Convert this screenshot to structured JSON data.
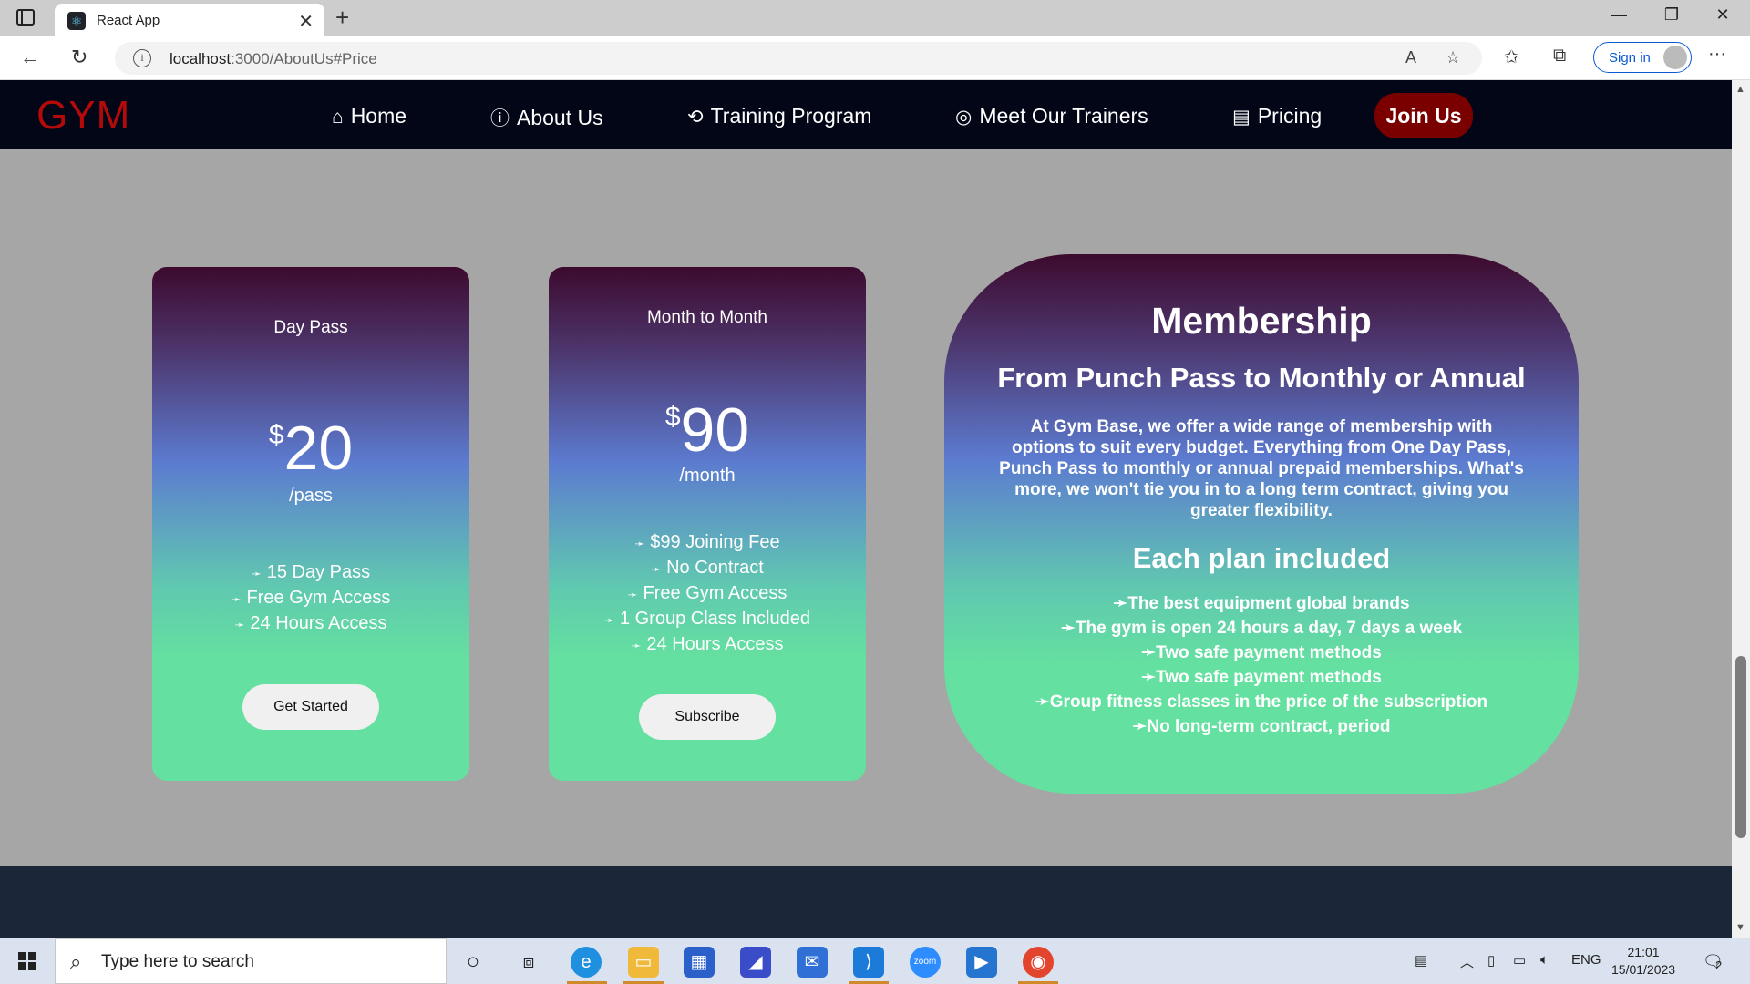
{
  "browser": {
    "tab_title": "React App",
    "url_host": "localhost",
    "url_path": ":3000/AboutUs#Price",
    "sign_in": "Sign in"
  },
  "site": {
    "logo": "GYM",
    "nav": [
      {
        "label": "Home",
        "icon": "home-icon"
      },
      {
        "label": "About Us",
        "icon": "info-icon"
      },
      {
        "label": "Training Program",
        "icon": "training-icon"
      },
      {
        "label": "Meet Our Trainers",
        "icon": "trainers-icon"
      },
      {
        "label": "Pricing",
        "icon": "pricing-icon"
      }
    ],
    "join": "Join Us"
  },
  "plans": [
    {
      "name": "Day Pass",
      "currency": "$",
      "price": "20",
      "unit": "/pass",
      "features": [
        "15 Day Pass",
        "Free Gym Access",
        "24 Hours Access"
      ],
      "button": "Get Started"
    },
    {
      "name": "Month to Month",
      "currency": "$",
      "price": "90",
      "unit": "/month",
      "features": [
        "$99 Joining Fee",
        "No Contract",
        "Free Gym Access",
        "1 Group Class Included",
        "24 Hours Access"
      ],
      "button": "Subscribe"
    }
  ],
  "membership": {
    "title": "Membership",
    "subtitle": "From Punch Pass to Monthly or Annual",
    "description": "At Gym Base, we offer a wide range of membership with options to suit every budget. Everything from One Day Pass, Punch Pass to monthly or annual prepaid memberships. What's more, we won't tie you in to a long term contract, giving you greater flexibility.",
    "included_heading": "Each plan included",
    "included": [
      "The best equipment global brands",
      "The gym is open 24 hours a day, 7 days a week",
      "Two safe payment methods",
      "Two safe payment methods",
      "Group fitness classes in the price of the subscription",
      "No long-term contract, period"
    ]
  },
  "taskbar": {
    "search_placeholder": "Type here to search",
    "language": "ENG",
    "time": "21:01",
    "date": "15/01/2023",
    "notifications": "2"
  }
}
